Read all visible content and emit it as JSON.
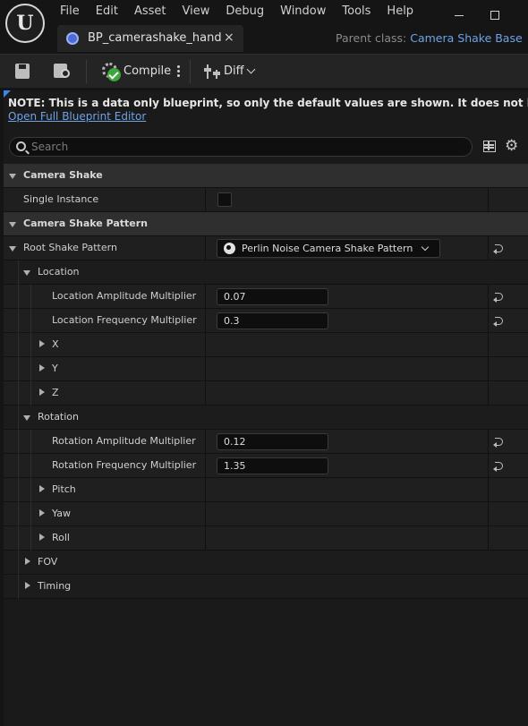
{
  "app": {
    "logo_text": "U",
    "menu": [
      "File",
      "Edit",
      "Asset",
      "View",
      "Debug",
      "Window",
      "Tools",
      "Help"
    ]
  },
  "tab": {
    "title": "BP_camerashake_hand",
    "close": "×"
  },
  "parent_class": {
    "label": "Parent class:",
    "value": "Camera Shake Base"
  },
  "toolbar": {
    "compile_label": "Compile",
    "diff_label": "Diff"
  },
  "notice": {
    "text": "NOTE: This is a data only blueprint, so only the default values are shown.  It does not have any script",
    "link": "Open Full Blueprint Editor"
  },
  "search": {
    "placeholder": "Search"
  },
  "details": {
    "camera_shake": {
      "header": "Camera Shake",
      "single_instance_label": "Single Instance",
      "single_instance_checked": false
    },
    "pattern": {
      "header": "Camera Shake Pattern",
      "root_label": "Root Shake Pattern",
      "root_value": "Perlin Noise Camera Shake Pattern",
      "location": {
        "label": "Location",
        "amp_label": "Location Amplitude Multiplier",
        "amp_value": "0.07",
        "freq_label": "Location Frequency Multiplier",
        "freq_value": "0.3",
        "x": "X",
        "y": "Y",
        "z": "Z"
      },
      "rotation": {
        "label": "Rotation",
        "amp_label": "Rotation Amplitude Multiplier",
        "amp_value": "0.12",
        "freq_label": "Rotation Frequency Multiplier",
        "freq_value": "1.35",
        "pitch": "Pitch",
        "yaw": "Yaw",
        "roll": "Roll"
      },
      "fov": "FOV",
      "timing": "Timing"
    }
  },
  "colors": {
    "accent_link": "#6fa3e6",
    "compile_ok": "#3ca73c",
    "panel_bg": "#1a1a1a",
    "category_bg": "#2f2f2f"
  }
}
